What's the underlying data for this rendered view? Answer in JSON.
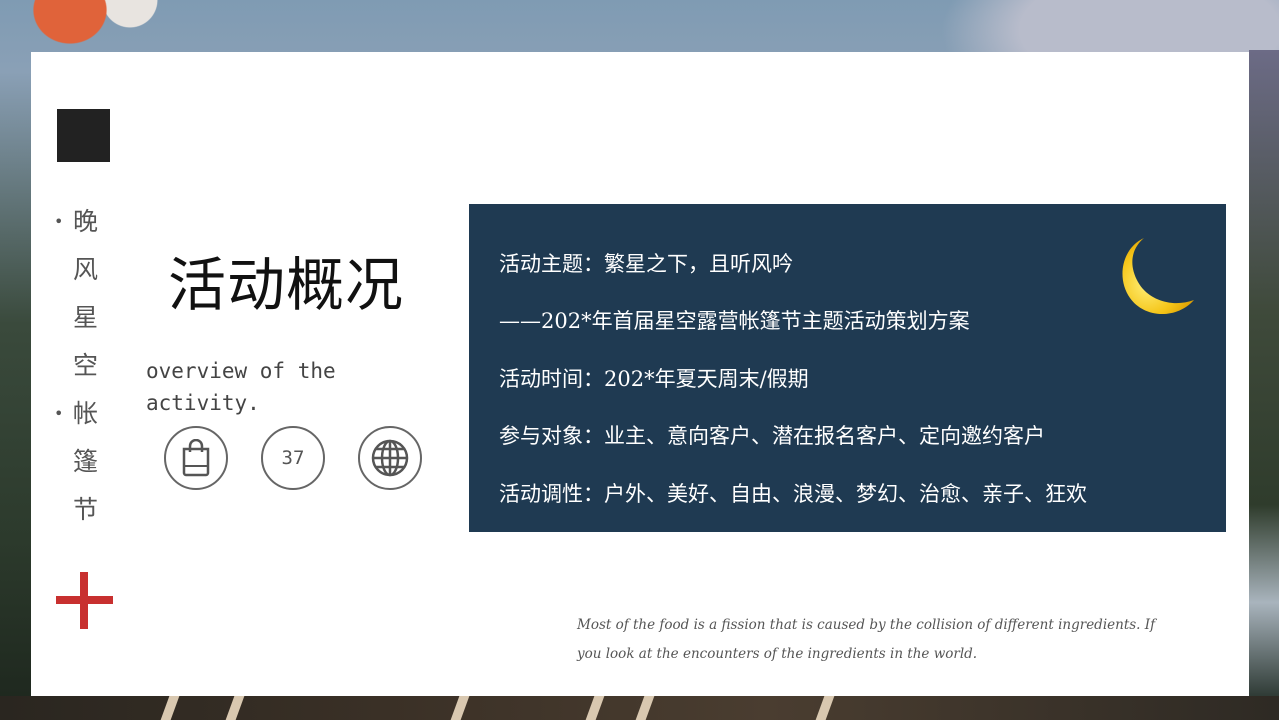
{
  "sidebar": {
    "vertical_chars": [
      "晚",
      "风",
      "星",
      "空",
      "帐",
      "篷",
      "节"
    ],
    "bullet": "•"
  },
  "heading": {
    "title": "活动概况",
    "subtitle": "overview of the activity."
  },
  "icons": {
    "badge_number": "37",
    "items": [
      "shopping-bag-icon",
      "number-badge",
      "globe-icon"
    ]
  },
  "panel": {
    "lines": [
      "活动主题：繁星之下，且听风吟",
      "——202*年首届星空露营帐篷节主题活动策划方案",
      "活动时间：202*年夏天周末/假期",
      "参与对象：业主、意向客户、潜在报名客户、定向邀约客户",
      "活动调性：户外、美好、自由、浪漫、梦幻、治愈、亲子、狂欢"
    ],
    "moon_icon": "crescent-moon-icon"
  },
  "footnote": "Most of the food is a fission that is caused by the collision of different ingredients. If you look at the encounters of the ingredients in the world.",
  "colors": {
    "panel_bg": "#1f3a52",
    "accent_red": "#c8302f",
    "dark_square": "#222222",
    "moon_yellow": "#f5c518"
  }
}
